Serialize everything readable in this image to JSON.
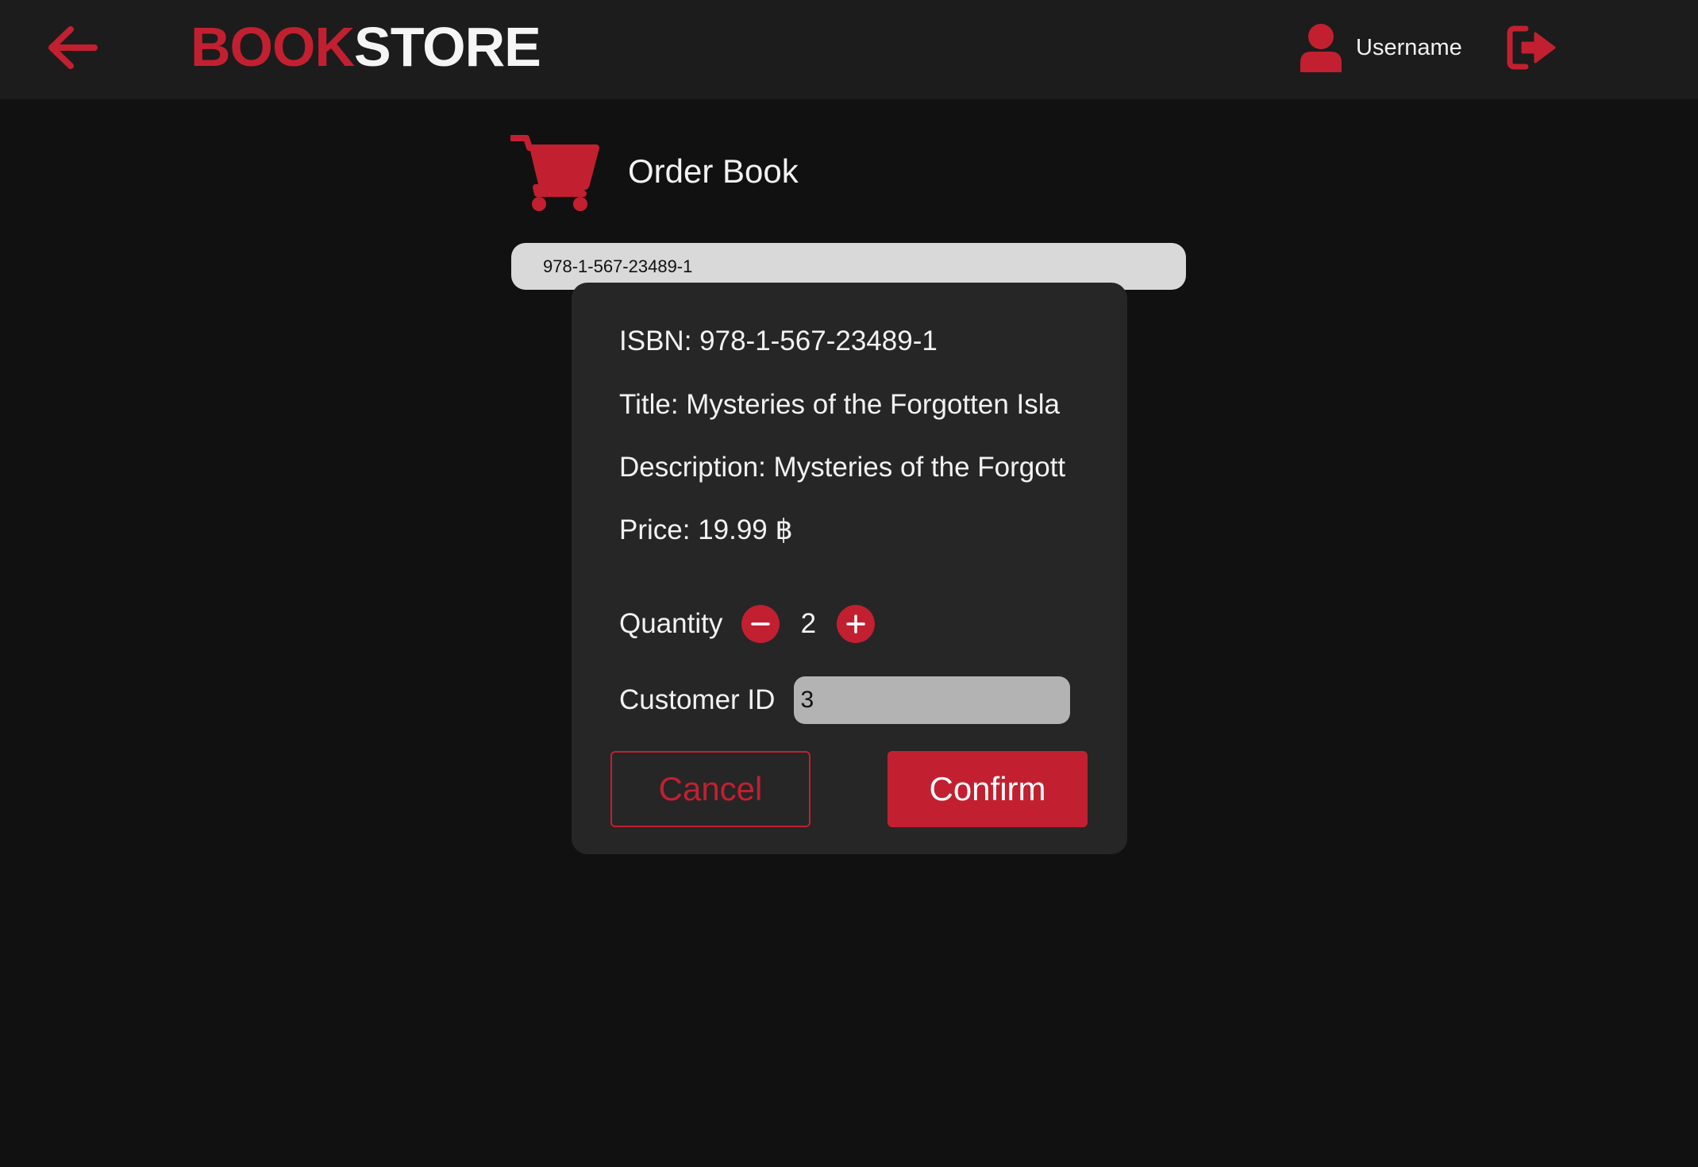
{
  "header": {
    "back_icon": "arrow-left-icon",
    "brand_part1": "BOOK",
    "brand_part2": "STORE",
    "user_icon": "user-icon",
    "username": "Username",
    "logout_icon": "logout-icon"
  },
  "page": {
    "title": "Order Book",
    "title_icon": "shopping-cart-icon"
  },
  "search": {
    "value": "978-1-567-23489-1"
  },
  "order": {
    "isbn": "ISBN: 978-1-567-23489-1",
    "title": "Title:  Mysteries of the Forgotten Isla",
    "description": "Description: Mysteries of the Forgott",
    "price": "Price: 19.99 ฿",
    "quantity_label": "Quantity",
    "quantity_value": "2",
    "customer_label": "Customer ID",
    "customer_value": "3",
    "cancel_label": "Cancel",
    "confirm_label": "Confirm"
  },
  "colors": {
    "accent": "#c22030",
    "background": "#111111",
    "topbar": "#1c1c1c",
    "panel": "#262626"
  }
}
